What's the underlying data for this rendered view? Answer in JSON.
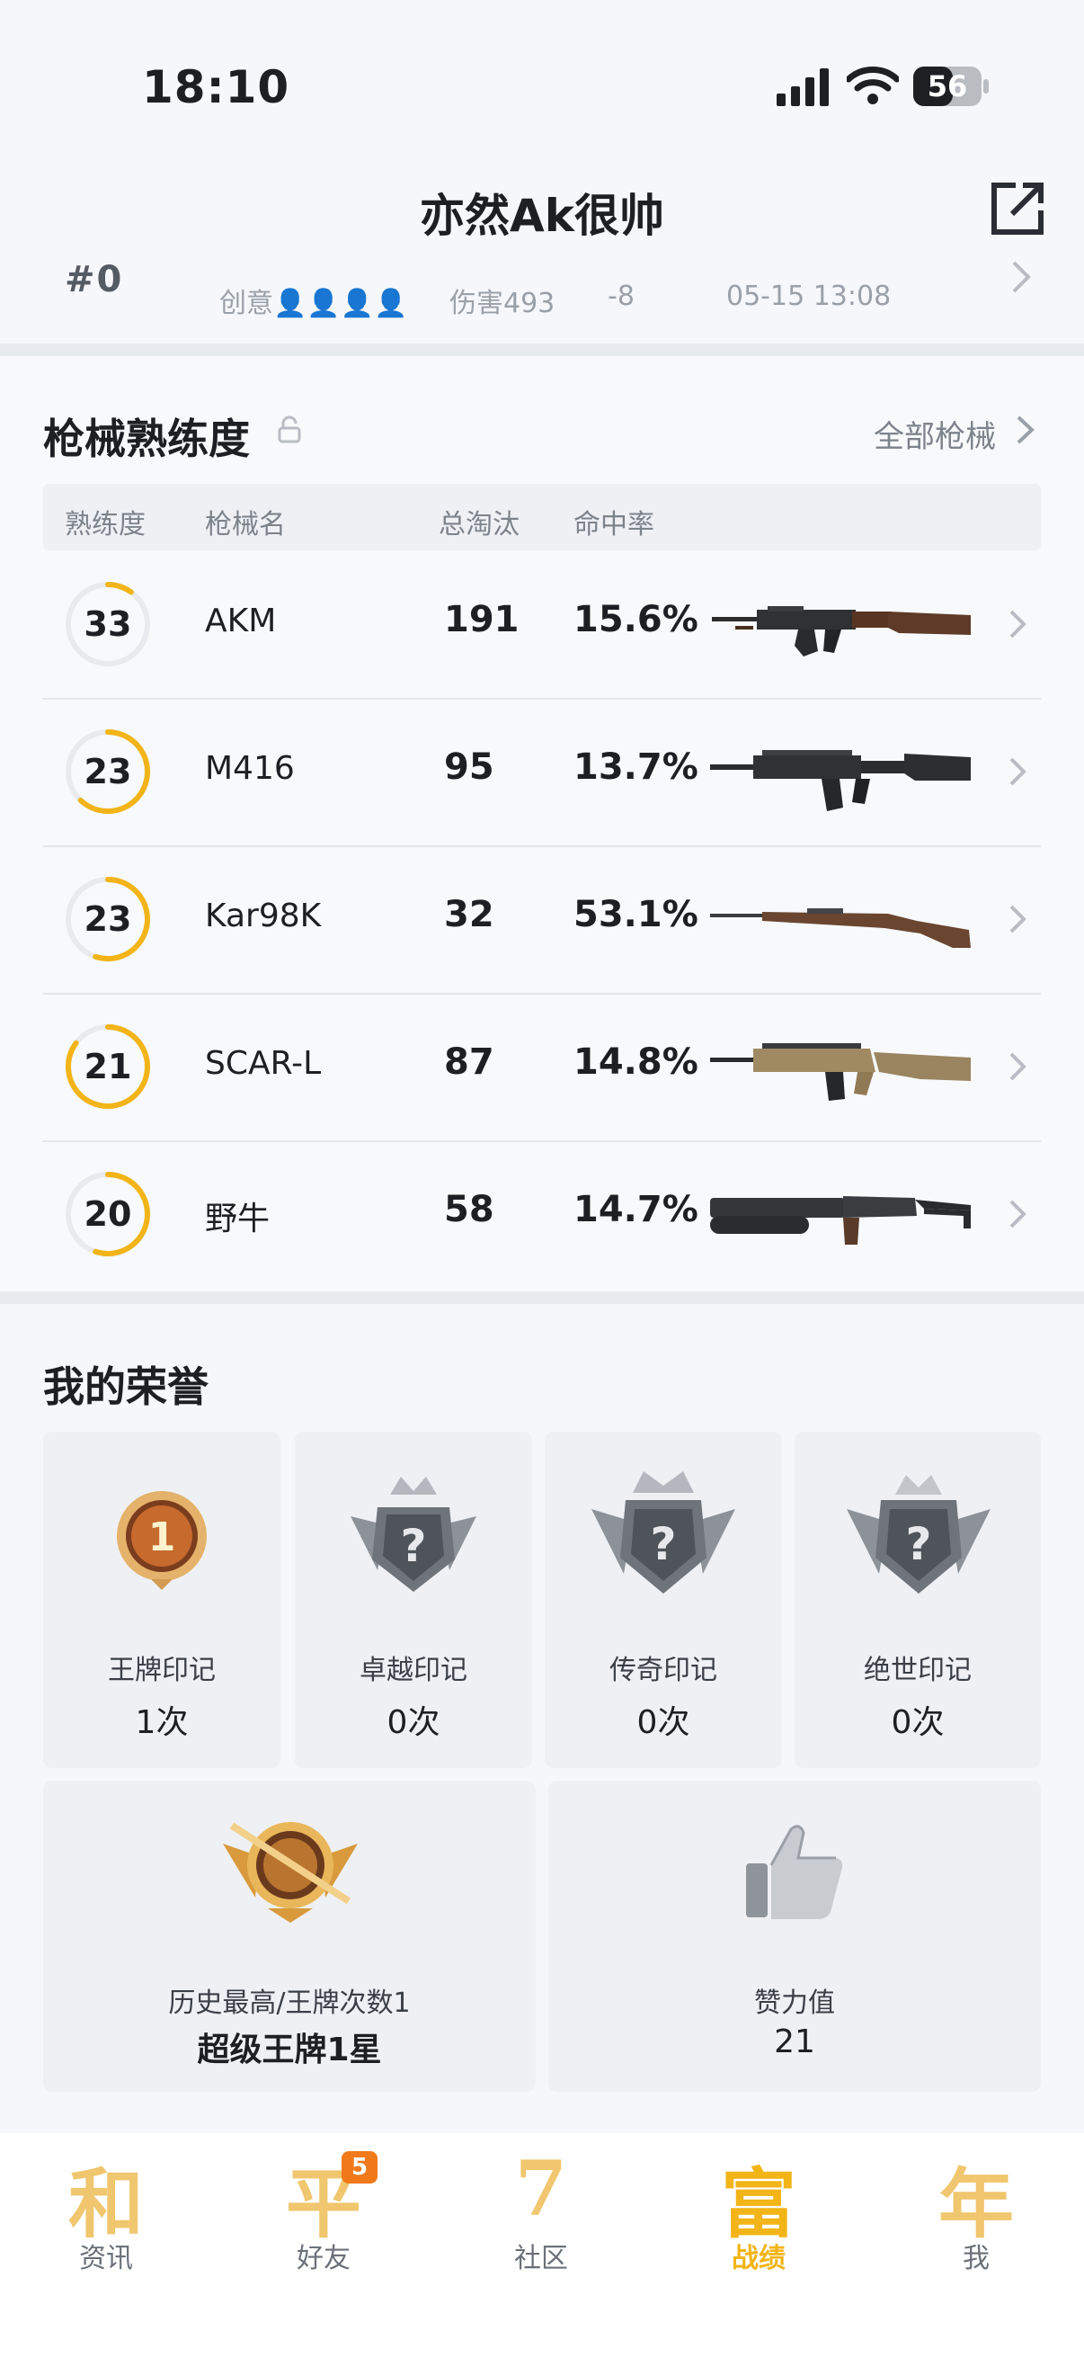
{
  "status_bar": {
    "time": "18:10",
    "battery": "56"
  },
  "header": {
    "title": "亦然Ak很帅"
  },
  "match_strip": {
    "rank": "#0",
    "mode": "创意👤👤👤👤",
    "damage": "伤害493",
    "delta": "-8",
    "date": "05-15 13:08"
  },
  "weapon_section": {
    "title": "枪械熟练度",
    "all_link": "全部枪械",
    "columns": [
      "熟练度",
      "枪械名",
      "总淘汰",
      "命中率"
    ],
    "rows": [
      {
        "level": "33",
        "name": "AKM",
        "kills": "191",
        "rate": "15.6%",
        "progress": 0.1
      },
      {
        "level": "23",
        "name": "M416",
        "kills": "95",
        "rate": "13.7%",
        "progress": 0.62
      },
      {
        "level": "23",
        "name": "Kar98K",
        "kills": "32",
        "rate": "53.1%",
        "progress": 0.55
      },
      {
        "level": "21",
        "name": "SCAR-L",
        "kills": "87",
        "rate": "14.8%",
        "progress": 0.85
      },
      {
        "level": "20",
        "name": "野牛",
        "kills": "58",
        "rate": "14.7%",
        "progress": 0.55
      }
    ]
  },
  "honors": {
    "title": "我的荣誉",
    "marks": [
      {
        "label": "王牌印记",
        "value": "1次"
      },
      {
        "label": "卓越印记",
        "value": "0次"
      },
      {
        "label": "传奇印记",
        "value": "0次"
      },
      {
        "label": "绝世印记",
        "value": "0次"
      }
    ],
    "highest": {
      "label": "历史最高/王牌次数1",
      "value": "超级王牌1星"
    },
    "likes": {
      "label": "赞力值",
      "value": "21"
    }
  },
  "nav": {
    "items": [
      {
        "glyph": "和",
        "label": "资讯"
      },
      {
        "glyph": "平",
        "label": "好友",
        "badge": "5"
      },
      {
        "glyph": "7",
        "label": "社区"
      },
      {
        "glyph": "富",
        "label": "战绩"
      },
      {
        "glyph": "年",
        "label": "我"
      }
    ],
    "active": "战绩"
  },
  "colors": {
    "accent": "#f2b417",
    "ring_track": "#e8eaee",
    "badge": "#f07a1a"
  }
}
